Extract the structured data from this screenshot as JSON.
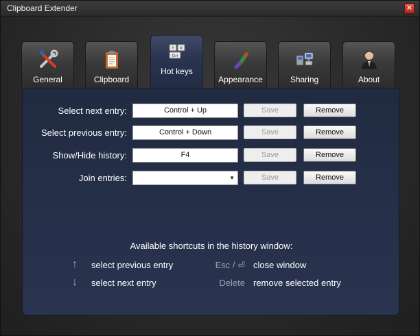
{
  "window": {
    "title": "Clipboard Extender",
    "close": "✕"
  },
  "tabs": [
    {
      "label": "General",
      "icon": "tools-icon"
    },
    {
      "label": "Clipboard",
      "icon": "clipboard-icon"
    },
    {
      "label": "Hot keys",
      "icon": "keyboard-icon",
      "active": true
    },
    {
      "label": "Appearance",
      "icon": "paint-icon"
    },
    {
      "label": "Sharing",
      "icon": "network-icon"
    },
    {
      "label": "About",
      "icon": "person-icon"
    }
  ],
  "hotkeys": [
    {
      "label": "Select next entry:",
      "value": "Control + Up",
      "save": "Save",
      "remove": "Remove"
    },
    {
      "label": "Select previous entry:",
      "value": "Control + Down",
      "save": "Save",
      "remove": "Remove"
    },
    {
      "label": "Show/Hide history:",
      "value": "F4",
      "save": "Save",
      "remove": "Remove"
    },
    {
      "label": "Join entries:",
      "value": "",
      "save": "Save",
      "remove": "Remove"
    }
  ],
  "shortcuts": {
    "title": "Available shortcuts in the history window:",
    "items": [
      {
        "key": "↑",
        "text": "select previous entry"
      },
      {
        "key": "↓",
        "text": "select next entry"
      },
      {
        "key": "Esc / ⏎",
        "text": "close window"
      },
      {
        "key": "Delete",
        "text": "remove selected entry"
      }
    ]
  }
}
